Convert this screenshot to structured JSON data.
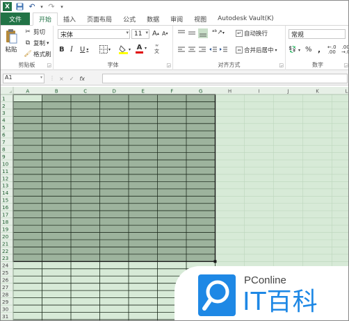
{
  "quick_access": {
    "logo": "X",
    "save": "💾",
    "undo": "↶",
    "redo": "↷"
  },
  "tabs": [
    {
      "label": "文件",
      "kind": "file"
    },
    {
      "label": "开始",
      "kind": "active"
    },
    {
      "label": "插入",
      "kind": ""
    },
    {
      "label": "页面布局",
      "kind": ""
    },
    {
      "label": "公式",
      "kind": ""
    },
    {
      "label": "数据",
      "kind": ""
    },
    {
      "label": "审阅",
      "kind": ""
    },
    {
      "label": "视图",
      "kind": ""
    },
    {
      "label": "Autodesk Vault(K)",
      "kind": ""
    }
  ],
  "ribbon": {
    "clipboard": {
      "paste": "粘贴",
      "cut": "剪切",
      "copy": "复制",
      "format_painter": "格式刷",
      "label": "剪贴板"
    },
    "font": {
      "name": "宋体",
      "size": "11",
      "grow": "A",
      "shrink": "A",
      "bold": "B",
      "italic": "I",
      "underline": "U",
      "font_color": "A",
      "label": "字体"
    },
    "alignment": {
      "wrap": "自动换行",
      "merge": "合并后居中",
      "label": "对齐方式"
    },
    "number": {
      "format": "常规",
      "percent": "%",
      "comma": ",",
      "label": "数字"
    }
  },
  "formula_bar": {
    "name_box": "A1",
    "fx": "fx",
    "cancel": "×",
    "enter": "✓",
    "value": ""
  },
  "grid": {
    "columns": [
      "A",
      "B",
      "C",
      "D",
      "E",
      "F",
      "G",
      "H",
      "I",
      "J",
      "K",
      "L"
    ],
    "rows": [
      "1",
      "2",
      "3",
      "4",
      "5",
      "6",
      "7",
      "8",
      "9",
      "10",
      "11",
      "12",
      "13",
      "14",
      "15",
      "16",
      "17",
      "18",
      "19",
      "20",
      "21",
      "22",
      "23",
      "24",
      "25",
      "26",
      "27",
      "28",
      "29",
      "30",
      "31"
    ],
    "bordered_rows": 23,
    "bordered_cols": 7,
    "colors": {
      "selected": "#9db39d",
      "sheet": "#d7ead7",
      "header": "#e6efe6",
      "border": "#1c2a1c",
      "light_grid": "#bcd5bc"
    }
  },
  "watermark": {
    "brand": "PConline",
    "title": "IT百科",
    "color": "#1e88e5"
  }
}
